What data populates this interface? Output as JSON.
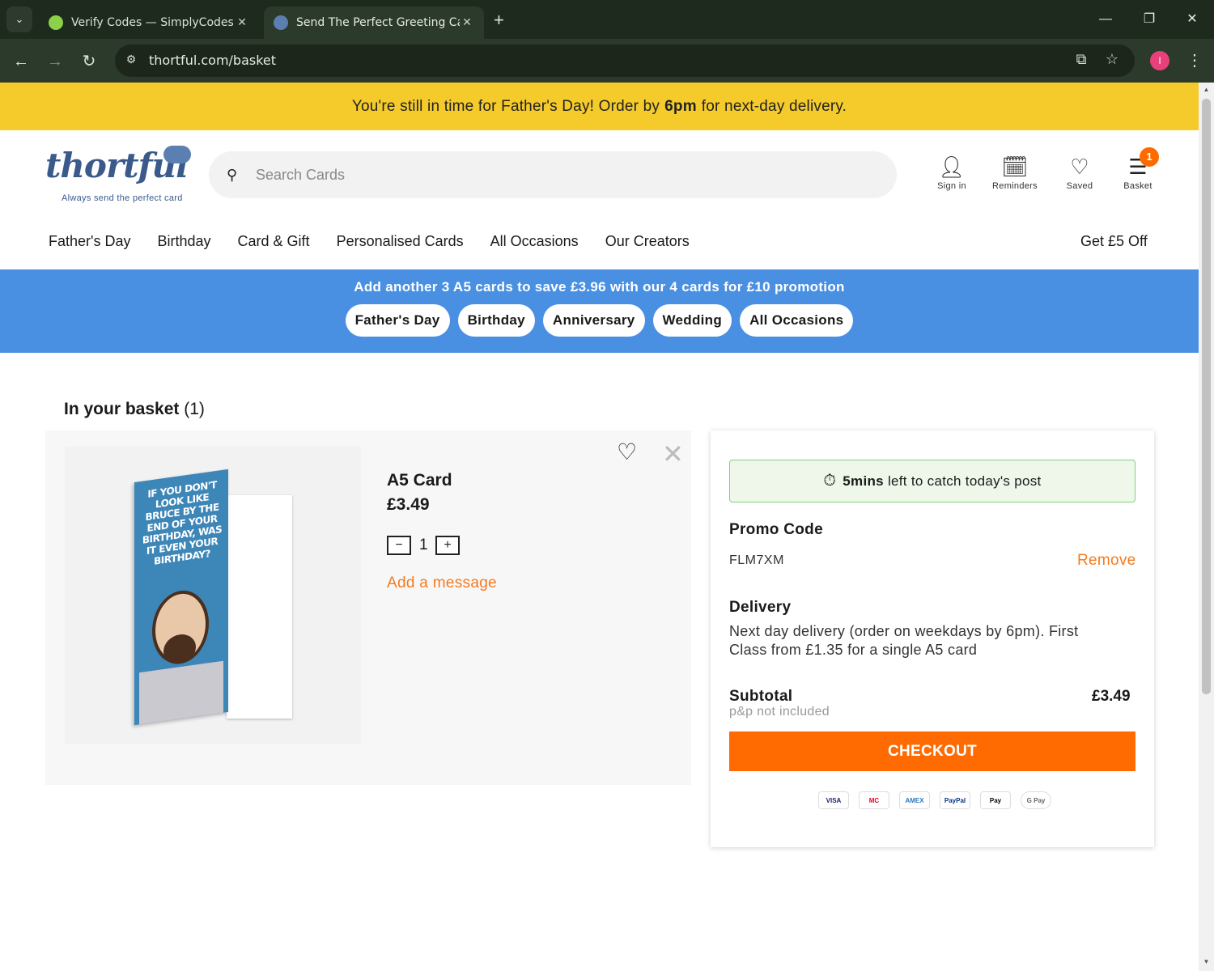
{
  "browser": {
    "tabs": [
      {
        "title": "Verify Codes — SimplyCodes",
        "fav_color": "#8bd14a"
      },
      {
        "title": "Send The Perfect Greeting Card",
        "fav_color": "#5a7fb0"
      }
    ],
    "url": "thortful.com/basket",
    "profile_initial": "I"
  },
  "site": {
    "announcement_pre": "You're still in time for Father's Day! Order by",
    "announcement_bold": "6pm",
    "announcement_post": "for next-day delivery.",
    "logo_text": "thortful",
    "logo_tagline": "Always send the perfect card",
    "search_placeholder": "Search Cards",
    "header_icons": [
      {
        "label": "Sign in",
        "icon": "user-icon"
      },
      {
        "label": "Reminders",
        "icon": "calendar-icon"
      },
      {
        "label": "Saved",
        "icon": "heart-icon"
      },
      {
        "label": "Basket",
        "icon": "basket-icon"
      }
    ],
    "basket_count": "1",
    "nav": [
      "Father's Day",
      "Birthday",
      "Card & Gift",
      "Personalised Cards",
      "All Occasions",
      "Our Creators"
    ],
    "nav_right": "Get £5 Off",
    "promotion_msg": "Add another 3 A5 cards to save £3.96 with our 4 cards for £10 promotion",
    "promotion_chips": [
      "Father's Day",
      "Birthday",
      "Anniversary",
      "Wedding",
      "All Occasions"
    ]
  },
  "basket": {
    "title": "In your basket",
    "count": "(1)",
    "item": {
      "name": "A5 Card",
      "price": "£3.49",
      "quantity": "1",
      "add_message": "Add a message",
      "card_text": "IF YOU DON'T LOOK LIKE BRUCE BY THE END OF YOUR BIRTHDAY, WAS IT EVEN YOUR BIRTHDAY?"
    }
  },
  "summary": {
    "post_bold": "5mins",
    "post_text": "left to catch today's post",
    "promo_heading": "Promo Code",
    "promo_code": "FLM7XM",
    "promo_remove": "Remove",
    "delivery_heading": "Delivery",
    "delivery_text": "Next day delivery (order on weekdays by 6pm). First Class from £1.35 for a single A5 card",
    "subtotal_heading": "Subtotal",
    "subtotal_value": "£3.49",
    "subtotal_note": "p&p not included",
    "checkout_label": "CHECKOUT",
    "payment_methods": [
      "VISA",
      "MC",
      "AMEX",
      "PayPal",
      "Pay",
      "G Pay"
    ]
  },
  "colors": {
    "accent": "#ff6b00",
    "announcement": "#f5cb2b",
    "promo_bar": "#4a90e2"
  }
}
